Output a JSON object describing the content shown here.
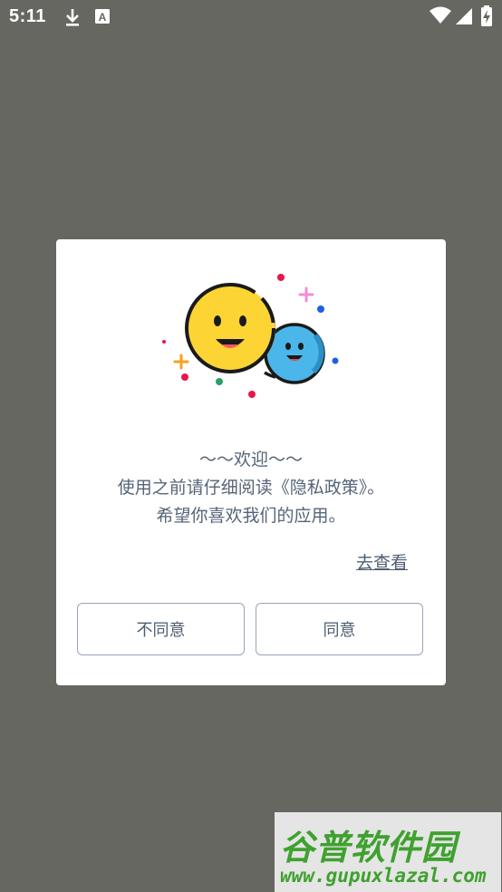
{
  "status_bar": {
    "time": "5:11",
    "icons": [
      "download-icon",
      "font-a-icon",
      "wifi-icon",
      "signal-icon",
      "battery-charging-icon"
    ]
  },
  "dialog": {
    "greeting": "～～欢迎～～",
    "line1": "使用之前请仔细阅读《隐私政策》。",
    "line2": "希望你喜欢我们的应用。",
    "view_link": "去查看",
    "disagree_button": "不同意",
    "agree_button": "同意"
  },
  "watermark": {
    "title": "谷普软件园",
    "url": "www.gupuxlazal.com"
  },
  "colors": {
    "overlay": "#676762",
    "text": "#556577",
    "button_border": "#9aa4b6",
    "emoji_yellow": "#fcd535",
    "emoji_blue": "#4ab6ea",
    "watermark_green": "#3fa12f"
  }
}
